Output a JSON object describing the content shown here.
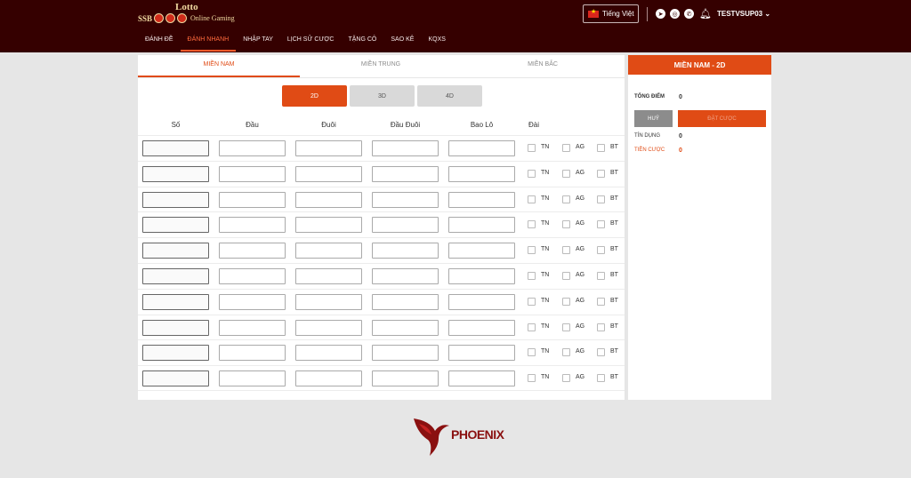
{
  "header": {
    "logo_top": "Lotto",
    "logo_left": "SSB",
    "logo_right": "Online Gaming",
    "nav": [
      "Đánh Đề",
      "Đánh Nhanh",
      "Nhập Tay",
      "Lịch Sử Cược",
      "Tặng Cô",
      "Sao Kê",
      "KQXS"
    ],
    "active_nav_index": 1,
    "language": "Tiếng Việt",
    "username": "TESTVSUP03 ⌄"
  },
  "region_tabs": [
    "Miền Nam",
    "Miền Trung",
    "Miền Bắc"
  ],
  "type_tabs": [
    "2D",
    "3D",
    "4D"
  ],
  "columns": [
    "Số",
    "Đầu",
    "Đuôi",
    "Đầu Đuôi",
    "Bao Lô",
    "Đài"
  ],
  "stations": [
    "TN",
    "AG",
    "BT"
  ],
  "row_count": 10,
  "side": {
    "title": "Miền Nam - 2D",
    "total_label": "Tổng Điểm",
    "total_value": "0",
    "cancel_label": "Huỷ",
    "bet_label": "Đặt Cược",
    "credit_label": "Tín Dụng",
    "credit_value": "0",
    "stake_label": "Tiền Cược",
    "stake_value": "0"
  },
  "footer": {
    "brand": "PHOENIX"
  },
  "colors": {
    "header": "#350000",
    "accent": "#e04b15",
    "stake": "#e04b15"
  }
}
